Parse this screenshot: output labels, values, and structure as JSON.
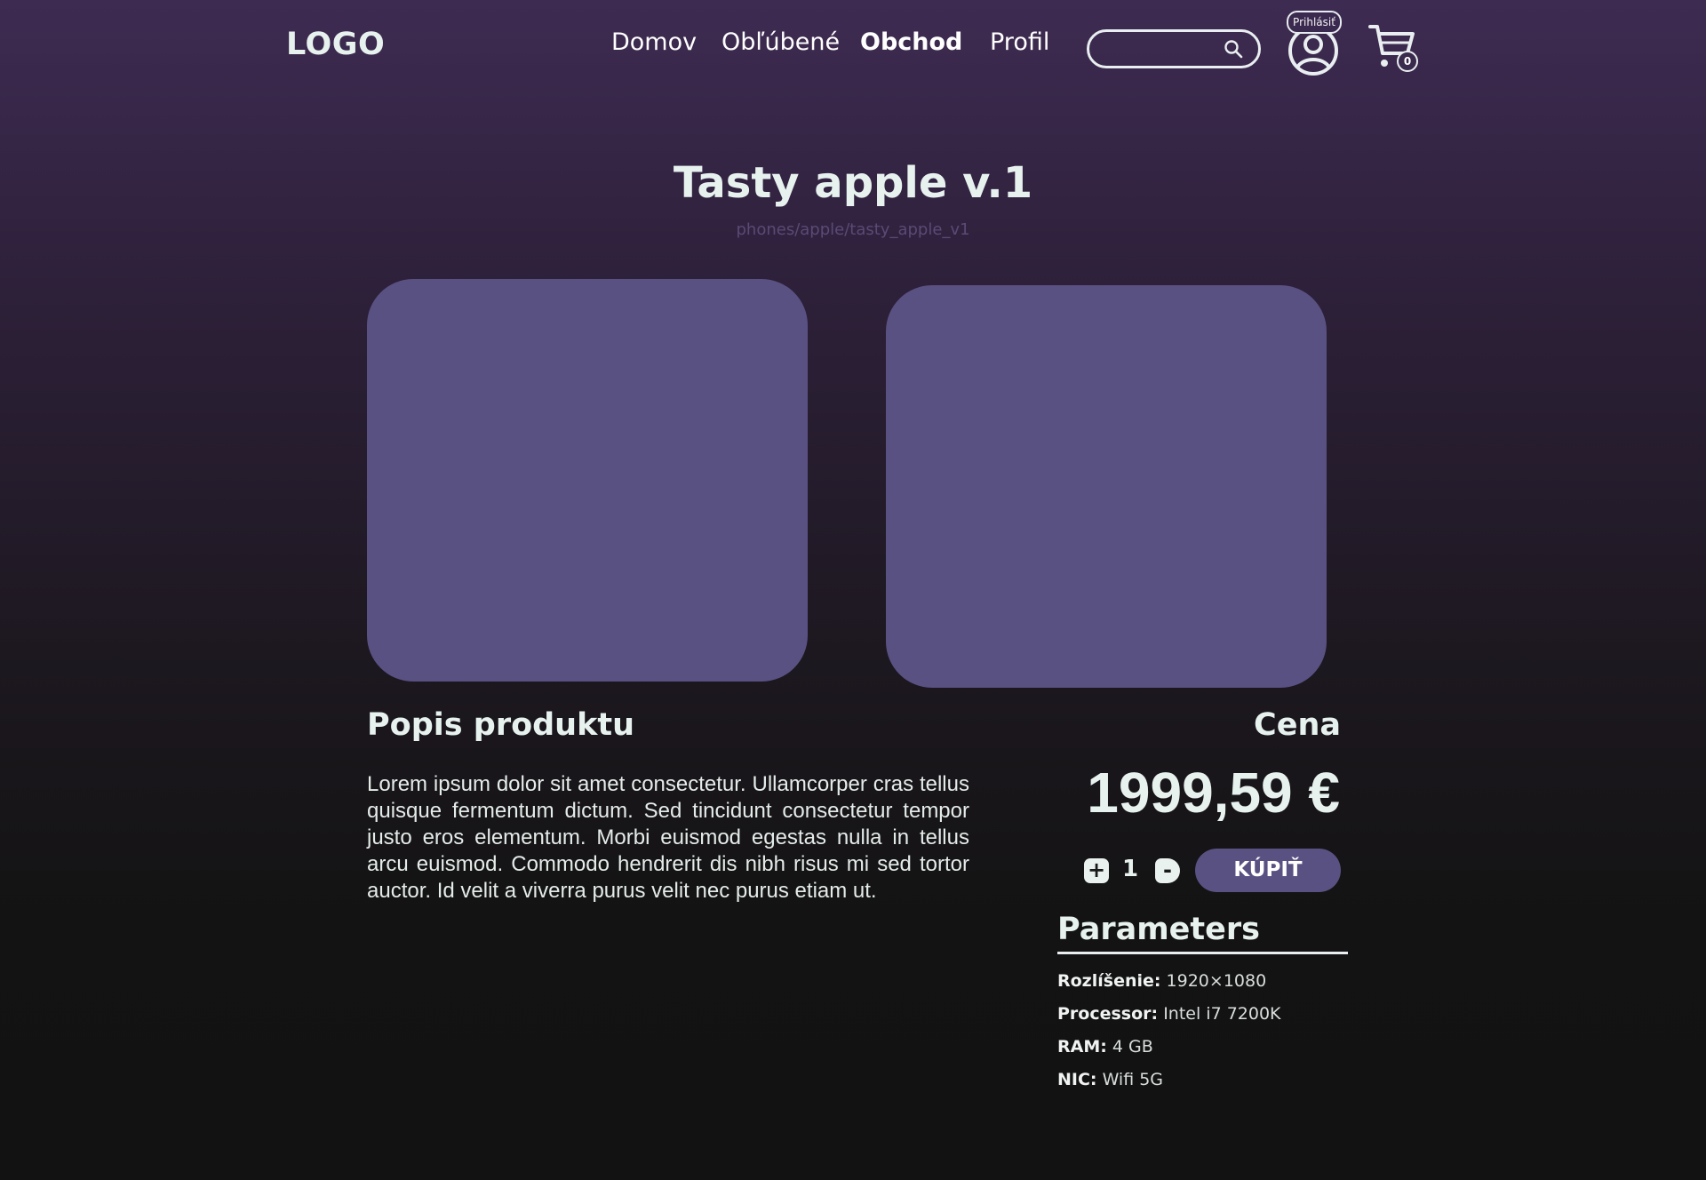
{
  "header": {
    "logo": "LOGO",
    "nav": [
      {
        "label": "Domov"
      },
      {
        "label": "Obľúbené"
      },
      {
        "label": "Obchod",
        "active": true
      },
      {
        "label": "Profil"
      }
    ],
    "search": {
      "placeholder": "",
      "icon": "search-icon"
    },
    "login_label": "Prihlásiť",
    "avatar_icon": "user-circle-icon",
    "cart": {
      "icon": "cart-icon",
      "count": "0"
    }
  },
  "product": {
    "title": "Tasty apple v.1",
    "breadcrumb": "phones/apple/tasty_apple_v1",
    "description_heading": "Popis produktu",
    "description": "Lorem ipsum dolor sit amet consectetur. Ullamcorper cras tellus quisque fermentum dictum. Sed tincidunt consectetur tempor justo eros elementum. Morbi euismod egestas nulla in tellus arcu euismod. Commodo hendrerit dis nibh risus mi sed tortor auctor. Id velit a viverra purus velit nec purus etiam ut.",
    "price_heading": "Cena",
    "price": "1999,59 €",
    "quantity": "1",
    "plus_label": "+",
    "minus_label": "-",
    "buy_label": "KÚPIŤ"
  },
  "parameters": {
    "heading": "Parameters",
    "items": [
      {
        "label": "Rozlíšenie:",
        "value": "1920×1080"
      },
      {
        "label": "Processor:",
        "value": "Intel i7 7200K"
      },
      {
        "label": "RAM:",
        "value": "4 GB"
      },
      {
        "label": "NIC:",
        "value": "Wifi 5G"
      }
    ]
  },
  "colors": {
    "accent": "#5a5183",
    "text": "#e7f2ef",
    "background_top": "#3e2b52",
    "background_bottom": "#121212"
  }
}
